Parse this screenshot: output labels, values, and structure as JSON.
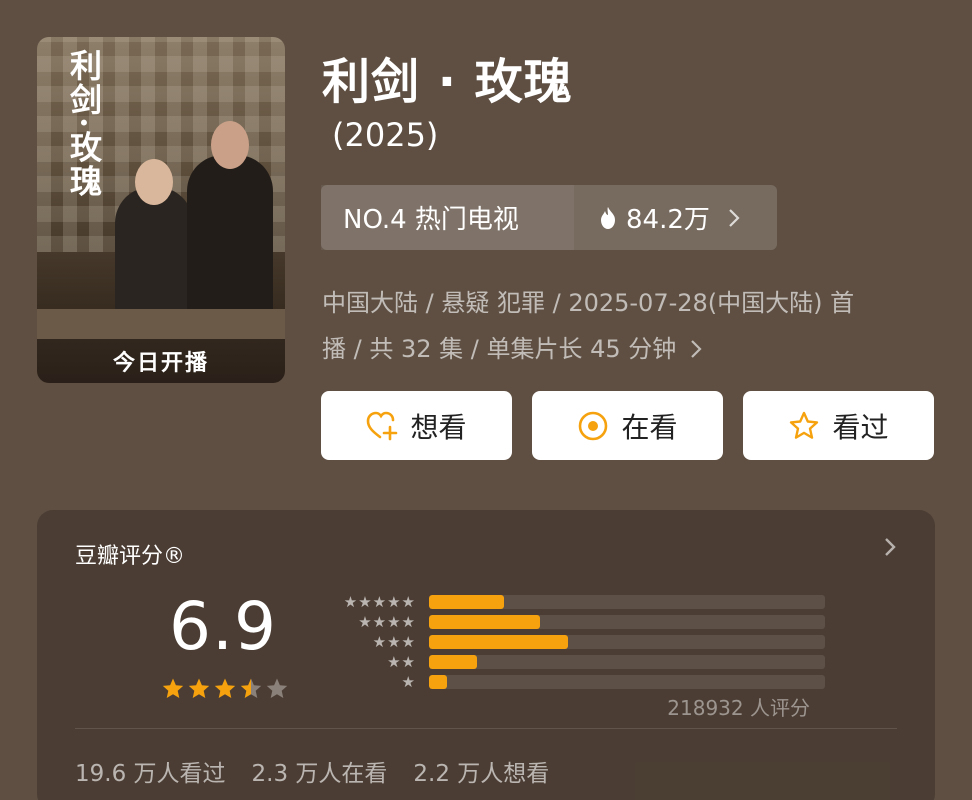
{
  "poster": {
    "title": "利剑·玫瑰",
    "banner": "今日开播"
  },
  "show": {
    "title": "利剑 · 玫瑰",
    "year": "(2025)"
  },
  "rank": {
    "label": "NO.4 热门电视",
    "heat": "84.2万",
    "flame_icon": "flame-icon",
    "chevron_icon": "chevron-right-icon"
  },
  "meta": {
    "line1": "中国大陆 / 悬疑 犯罪 / 2025-07-28(中国大陆) 首",
    "line2": "播 / 共 32 集 / 单集片长 45 分钟",
    "chevron_icon": "chevron-right-icon"
  },
  "actions": [
    {
      "label": "想看",
      "icon": "heart-plus-icon",
      "icon_color": "#f5a20e"
    },
    {
      "label": "在看",
      "icon": "target-icon",
      "icon_color": "#f5a20e"
    },
    {
      "label": "看过",
      "icon": "star-outline-icon",
      "icon_color": "#f5a20e"
    }
  ],
  "rating": {
    "title": "豆瓣评分®",
    "score": "6.9",
    "stars_value": 3.5,
    "stars_max": 5,
    "count": "218932 人评分",
    "distribution": [
      {
        "stars": 5,
        "fraction": 0.19
      },
      {
        "stars": 4,
        "fraction": 0.28
      },
      {
        "stars": 3,
        "fraction": 0.35
      },
      {
        "stars": 2,
        "fraction": 0.12
      },
      {
        "stars": 1,
        "fraction": 0.045
      }
    ],
    "accent": "#f5a20e",
    "stats": [
      "19.6 万人看过",
      "2.3 万人在看",
      "2.2 万人想看"
    ]
  }
}
